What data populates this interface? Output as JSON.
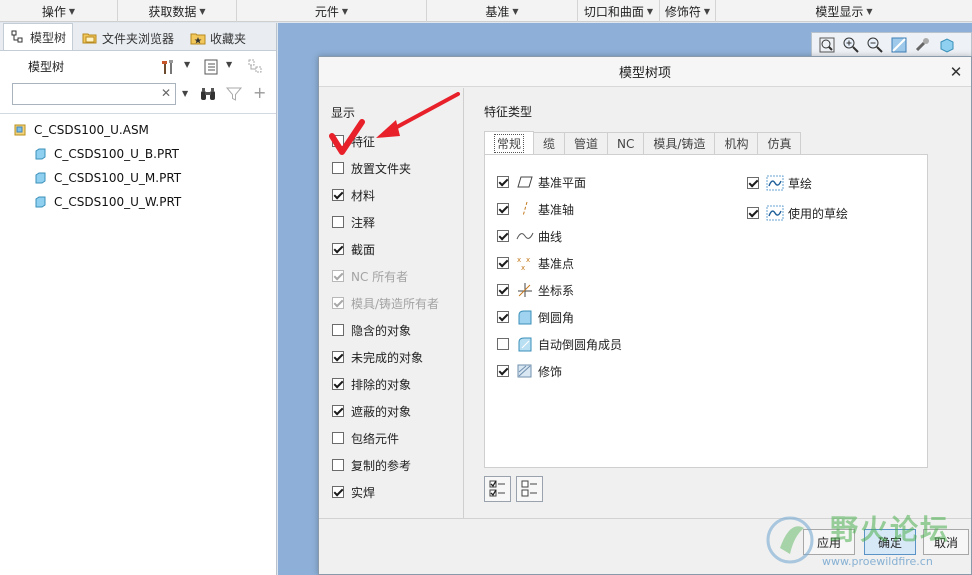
{
  "ribbon": {
    "groups": [
      {
        "label": "操作"
      },
      {
        "label": "获取数据"
      },
      {
        "label": "元件"
      },
      {
        "label": "基准"
      },
      {
        "label": "切口和曲面"
      },
      {
        "label": "修饰符"
      },
      {
        "label": "模型显示"
      }
    ]
  },
  "left_panel": {
    "tabs": [
      {
        "label": "模型树",
        "active": true,
        "icon": "model-tree-icon"
      },
      {
        "label": "文件夹浏览器",
        "active": false,
        "icon": "folder-browser-icon"
      },
      {
        "label": "收藏夹",
        "active": false,
        "icon": "favorites-icon"
      }
    ],
    "tree_title": "模型树",
    "search": {
      "value": "",
      "placeholder": ""
    },
    "tree_items": [
      {
        "label": "C_CSDS100_U.ASM",
        "type": "assembly"
      },
      {
        "label": "C_CSDS100_U_B.PRT",
        "type": "part"
      },
      {
        "label": "C_CSDS100_U_M.PRT",
        "type": "part"
      },
      {
        "label": "C_CSDS100_U_W.PRT",
        "type": "part"
      }
    ]
  },
  "dialog": {
    "title": "模型树项",
    "display_label": "显示",
    "display_items": [
      {
        "label": "特征",
        "checked": false,
        "enabled": true
      },
      {
        "label": "放置文件夹",
        "checked": false,
        "enabled": true
      },
      {
        "label": "材料",
        "checked": true,
        "enabled": true
      },
      {
        "label": "注释",
        "checked": false,
        "enabled": true
      },
      {
        "label": "截面",
        "checked": true,
        "enabled": true
      },
      {
        "label": "NC 所有者",
        "checked": true,
        "enabled": false
      },
      {
        "label": "模具/铸造所有者",
        "checked": true,
        "enabled": false
      },
      {
        "label": "隐含的对象",
        "checked": false,
        "enabled": true
      },
      {
        "label": "未完成的对象",
        "checked": true,
        "enabled": true
      },
      {
        "label": "排除的对象",
        "checked": true,
        "enabled": true
      },
      {
        "label": "遮蔽的对象",
        "checked": true,
        "enabled": true
      },
      {
        "label": "包络元件",
        "checked": false,
        "enabled": true
      },
      {
        "label": "复制的参考",
        "checked": false,
        "enabled": true
      },
      {
        "label": "实焊",
        "checked": true,
        "enabled": true
      }
    ],
    "feature_type_label": "特征类型",
    "feature_tabs": [
      {
        "label": "常规",
        "active": true
      },
      {
        "label": "缆",
        "active": false
      },
      {
        "label": "管道",
        "active": false
      },
      {
        "label": "NC",
        "active": false
      },
      {
        "label": "模具/铸造",
        "active": false
      },
      {
        "label": "机构",
        "active": false
      },
      {
        "label": "仿真",
        "active": false
      }
    ],
    "features_left": [
      {
        "label": "基准平面",
        "checked": true,
        "icon": "datum-plane-icon"
      },
      {
        "label": "基准轴",
        "checked": true,
        "icon": "datum-axis-icon"
      },
      {
        "label": "曲线",
        "checked": true,
        "icon": "curve-icon"
      },
      {
        "label": "基准点",
        "checked": true,
        "icon": "datum-point-icon"
      },
      {
        "label": "坐标系",
        "checked": true,
        "icon": "coordinate-system-icon"
      },
      {
        "label": "倒圆角",
        "checked": true,
        "icon": "round-icon"
      },
      {
        "label": "自动倒圆角成员",
        "checked": false,
        "icon": "auto-round-member-icon"
      },
      {
        "label": "修饰",
        "checked": true,
        "icon": "cosmetic-icon"
      }
    ],
    "features_right": [
      {
        "label": "草绘",
        "checked": true,
        "icon": "sketch-icon"
      },
      {
        "label": "使用的草绘",
        "checked": true,
        "icon": "used-sketch-icon"
      }
    ],
    "buttons": {
      "apply": "应用",
      "ok": "确定",
      "cancel": "取消"
    }
  },
  "watermark": {
    "text": "野火论坛",
    "url": "www.proewildfire.cn"
  },
  "colors": {
    "canvas_blue": "#8eb0d8",
    "annotation_red": "#e8202a",
    "accent": "#5c93c7"
  }
}
